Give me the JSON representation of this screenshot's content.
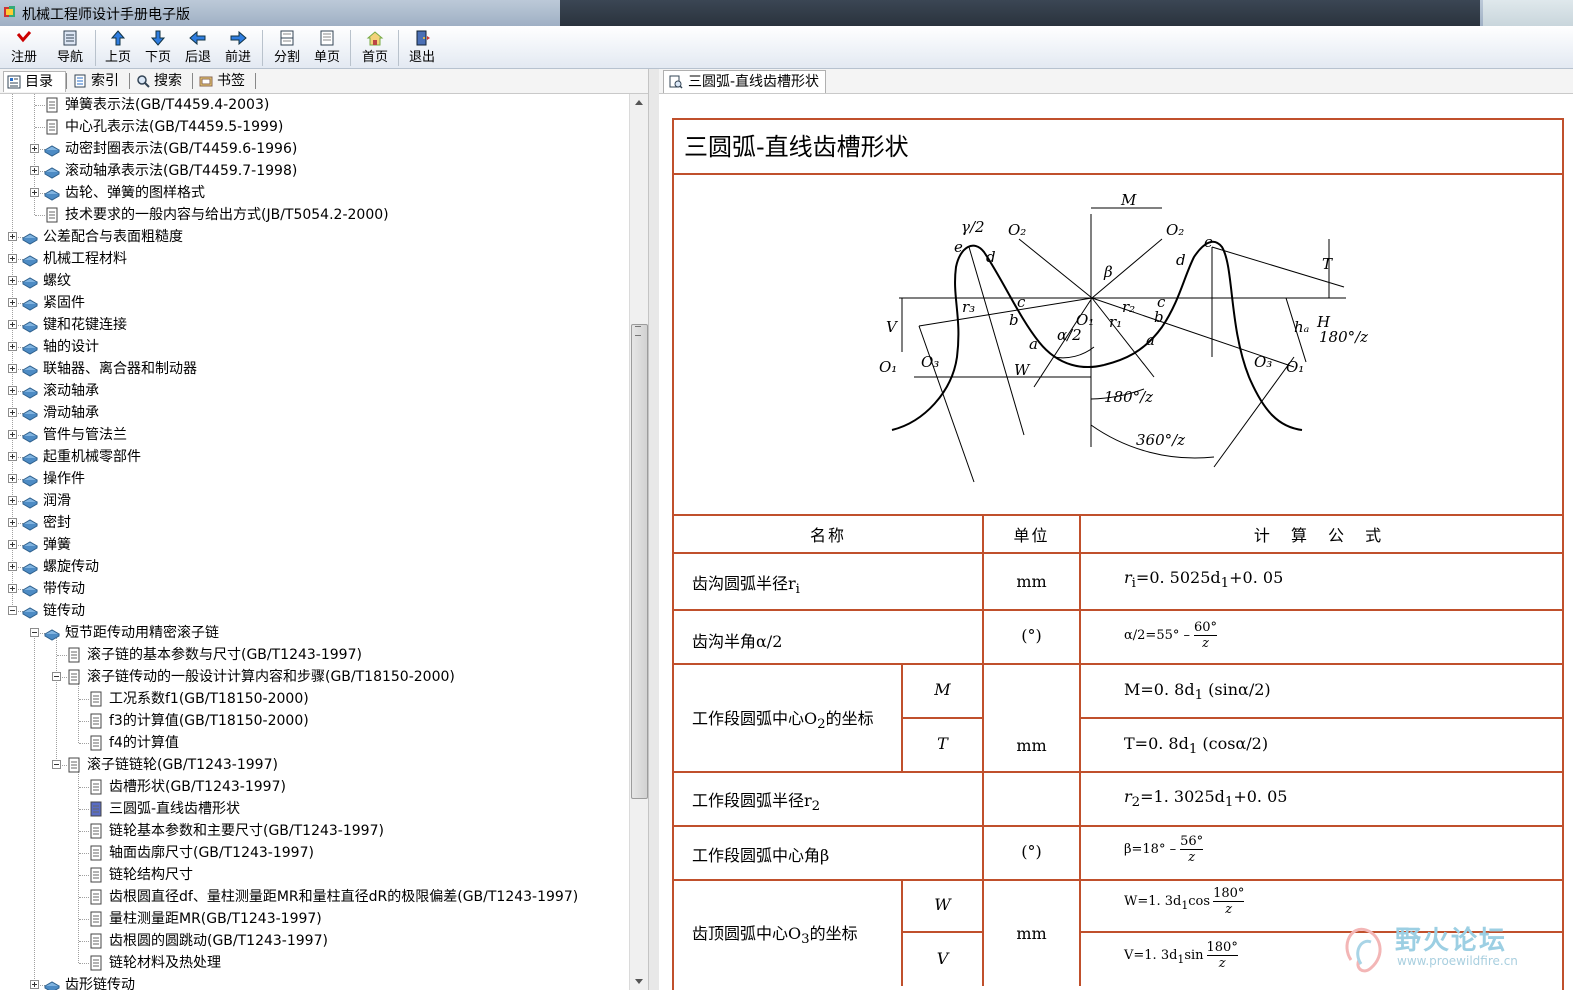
{
  "window": {
    "title": "机械工程师设计手册电子版"
  },
  "toolbar": [
    {
      "label": "注册",
      "icon": "register-icon"
    },
    {
      "label": "导航",
      "icon": "navigate-icon"
    },
    {
      "label": "上页",
      "icon": "arrow-up-icon"
    },
    {
      "label": "下页",
      "icon": "arrow-down-icon"
    },
    {
      "label": "后退",
      "icon": "arrow-left-icon"
    },
    {
      "label": "前进",
      "icon": "arrow-right-icon"
    },
    {
      "label": "分割",
      "icon": "split-icon"
    },
    {
      "label": "单页",
      "icon": "single-page-icon"
    },
    {
      "label": "首页",
      "icon": "home-icon"
    },
    {
      "label": "退出",
      "icon": "exit-icon"
    }
  ],
  "left_tabs": [
    {
      "label": "目录",
      "icon": "contents-icon",
      "active": true
    },
    {
      "label": "索引",
      "icon": "index-icon"
    },
    {
      "label": "搜索",
      "icon": "search-icon"
    },
    {
      "label": "书签",
      "icon": "bookmark-icon"
    }
  ],
  "tree": [
    {
      "label": "弹簧表示法(GB/T4459.4-2003)",
      "type": "page",
      "level": 1
    },
    {
      "label": "中心孔表示法(GB/T4459.5-1999)",
      "type": "page",
      "level": 1
    },
    {
      "label": "动密封圈表示法(GB/T4459.6-1996)",
      "type": "book",
      "level": 1,
      "expander": "plus"
    },
    {
      "label": "滚动轴承表示法(GB/T4459.7-1998)",
      "type": "book",
      "level": 1,
      "expander": "plus"
    },
    {
      "label": "齿轮、弹簧的图样格式",
      "type": "book",
      "level": 1,
      "expander": "plus"
    },
    {
      "label": "技术要求的一般内容与给出方式(JB/T5054.2-2000)",
      "type": "page",
      "level": 1
    },
    {
      "label": "公差配合与表面粗糙度",
      "type": "book",
      "level": 0,
      "expander": "plus"
    },
    {
      "label": "机械工程材料",
      "type": "book",
      "level": 0,
      "expander": "plus"
    },
    {
      "label": "螺纹",
      "type": "book",
      "level": 0,
      "expander": "plus"
    },
    {
      "label": "紧固件",
      "type": "book",
      "level": 0,
      "expander": "plus"
    },
    {
      "label": "键和花键连接",
      "type": "book",
      "level": 0,
      "expander": "plus"
    },
    {
      "label": "轴的设计",
      "type": "book",
      "level": 0,
      "expander": "plus"
    },
    {
      "label": "联轴器、离合器和制动器",
      "type": "book",
      "level": 0,
      "expander": "plus"
    },
    {
      "label": "滚动轴承",
      "type": "book",
      "level": 0,
      "expander": "plus"
    },
    {
      "label": "滑动轴承",
      "type": "book",
      "level": 0,
      "expander": "plus"
    },
    {
      "label": "管件与管法兰",
      "type": "book",
      "level": 0,
      "expander": "plus"
    },
    {
      "label": "起重机械零部件",
      "type": "book",
      "level": 0,
      "expander": "plus"
    },
    {
      "label": "操作件",
      "type": "book",
      "level": 0,
      "expander": "plus"
    },
    {
      "label": "润滑",
      "type": "book",
      "level": 0,
      "expander": "plus"
    },
    {
      "label": "密封",
      "type": "book",
      "level": 0,
      "expander": "plus"
    },
    {
      "label": "弹簧",
      "type": "book",
      "level": 0,
      "expander": "plus"
    },
    {
      "label": "螺旋传动",
      "type": "book",
      "level": 0,
      "expander": "plus"
    },
    {
      "label": "带传动",
      "type": "book",
      "level": 0,
      "expander": "plus"
    },
    {
      "label": "链传动",
      "type": "book",
      "level": 0,
      "expander": "minus"
    },
    {
      "label": "短节距传动用精密滚子链",
      "type": "book",
      "level": 1,
      "expander": "minus"
    },
    {
      "label": "滚子链的基本参数与尺寸(GB/T1243-1997)",
      "type": "page",
      "level": 2
    },
    {
      "label": "滚子链传动的一般设计计算内容和步骤(GB/T18150-2000)",
      "type": "page",
      "level": 2,
      "expander": "minus"
    },
    {
      "label": "工况系数f1(GB/T18150-2000)",
      "type": "page",
      "level": 3
    },
    {
      "label": "f3的计算值(GB/T18150-2000)",
      "type": "page",
      "level": 3
    },
    {
      "label": "f4的计算值",
      "type": "page",
      "level": 3
    },
    {
      "label": "滚子链链轮(GB/T1243-1997)",
      "type": "page",
      "level": 2,
      "expander": "minus"
    },
    {
      "label": "齿槽形状(GB/T1243-1997)",
      "type": "page",
      "level": 3
    },
    {
      "label": "三圆弧-直线齿槽形状",
      "type": "page",
      "level": 3,
      "selected": true
    },
    {
      "label": "链轮基本参数和主要尺寸(GB/T1243-1997)",
      "type": "page",
      "level": 3
    },
    {
      "label": "轴面齿廓尺寸(GB/T1243-1997)",
      "type": "page",
      "level": 3
    },
    {
      "label": "链轮结构尺寸",
      "type": "page",
      "level": 3
    },
    {
      "label": "齿根圆直径df、量柱测量距MR和量柱直径dR的极限偏差(GB/T1243-1997)",
      "type": "page",
      "level": 3
    },
    {
      "label": "量柱测量距MR(GB/T1243-1997)",
      "type": "page",
      "level": 3
    },
    {
      "label": "齿根圆的圆跳动(GB/T1243-1997)",
      "type": "page",
      "level": 3
    },
    {
      "label": "链轮材料及热处理",
      "type": "page",
      "level": 3
    },
    {
      "label": "齿形链传动",
      "type": "book",
      "level": 1,
      "expander": "plus"
    }
  ],
  "content_tab": {
    "label": "三圆弧-直线齿槽形状",
    "icon": "document-icon"
  },
  "doc": {
    "title": "三圆弧-直线齿槽形状",
    "figure_labels": {
      "M": "M",
      "gamma2": "γ/2",
      "O2a": "O₂",
      "O2b": "O₂",
      "e1": "e",
      "e2": "e",
      "d1": "d",
      "d2": "d",
      "beta": "β",
      "T": "T",
      "V": "V",
      "r3": "r₃",
      "c1": "c",
      "c2": "c",
      "b1": "b",
      "b2": "b",
      "r2": "r₂",
      "r1": "r₁",
      "O1c": "O₁",
      "alpha2": "α/2",
      "ha": "hₐ",
      "H": "H",
      "deg180": "180°/z",
      "O1a": "O₁",
      "O3a": "O₃",
      "a1": "a",
      "a2": "a",
      "W": "W",
      "O3b": "O₃",
      "O1b": "O₁",
      "deg180b": "180°/z",
      "deg360": "360°/z"
    },
    "table": {
      "headers": [
        "名称",
        "单位",
        "计 算 公 式"
      ],
      "rows": {
        "r1": {
          "name": "齿沟圆弧半径r",
          "sub": "i",
          "unit": "mm",
          "formula_a": "r",
          "formula_sub": "i",
          "formula_b": "=0. 5025d",
          "formula_sub2": "1",
          "formula_c": "+0. 05"
        },
        "r2": {
          "name": "齿沟半角α/2",
          "unit": "(°)",
          "formula_a": "α/2=55° –",
          "num": "60°",
          "den": "z"
        },
        "r3": {
          "name": "工作段圆弧中心O",
          "sub": "2",
          "name_tail": "的坐标",
          "m_label": "M",
          "t_label": "T",
          "unit": "mm",
          "formula_m": "M=0. 8d",
          "formula_m_sub": "1",
          "formula_m_tail": " (sinα/2)",
          "formula_t": "T=0. 8d",
          "formula_t_sub": "1",
          "formula_t_tail": " (cosα/2)"
        },
        "r4": {
          "name": "工作段圆弧半径r",
          "sub": "2",
          "formula_a": "r",
          "formula_sub": "2",
          "formula_b": "=1. 3025d",
          "formula_sub2": "1",
          "formula_c": "+0. 05"
        },
        "r5": {
          "name": "工作段圆弧中心角β",
          "unit": "(°)",
          "formula_a": "β=18° –",
          "num": "56°",
          "den": "z"
        },
        "r6": {
          "name": "齿顶圆弧中心O",
          "sub": "3",
          "name_tail": "的坐标",
          "w_label": "W",
          "v_label": "V",
          "unit": "mm",
          "formula_w": "W=1. 3d",
          "formula_w_sub": "1",
          "formula_w_tail": "cos",
          "w_num": "180°",
          "w_den": "z",
          "formula_v": "V=1. 3d",
          "formula_v_sub": "1",
          "formula_v_tail": "sin",
          "v_num": "180°",
          "v_den": "z"
        }
      }
    }
  },
  "watermark": {
    "text": "野火论坛",
    "url": "www.proewildfire.cn"
  },
  "colors": {
    "table_border": "#c0502c",
    "accent": "#2a6fc9"
  }
}
